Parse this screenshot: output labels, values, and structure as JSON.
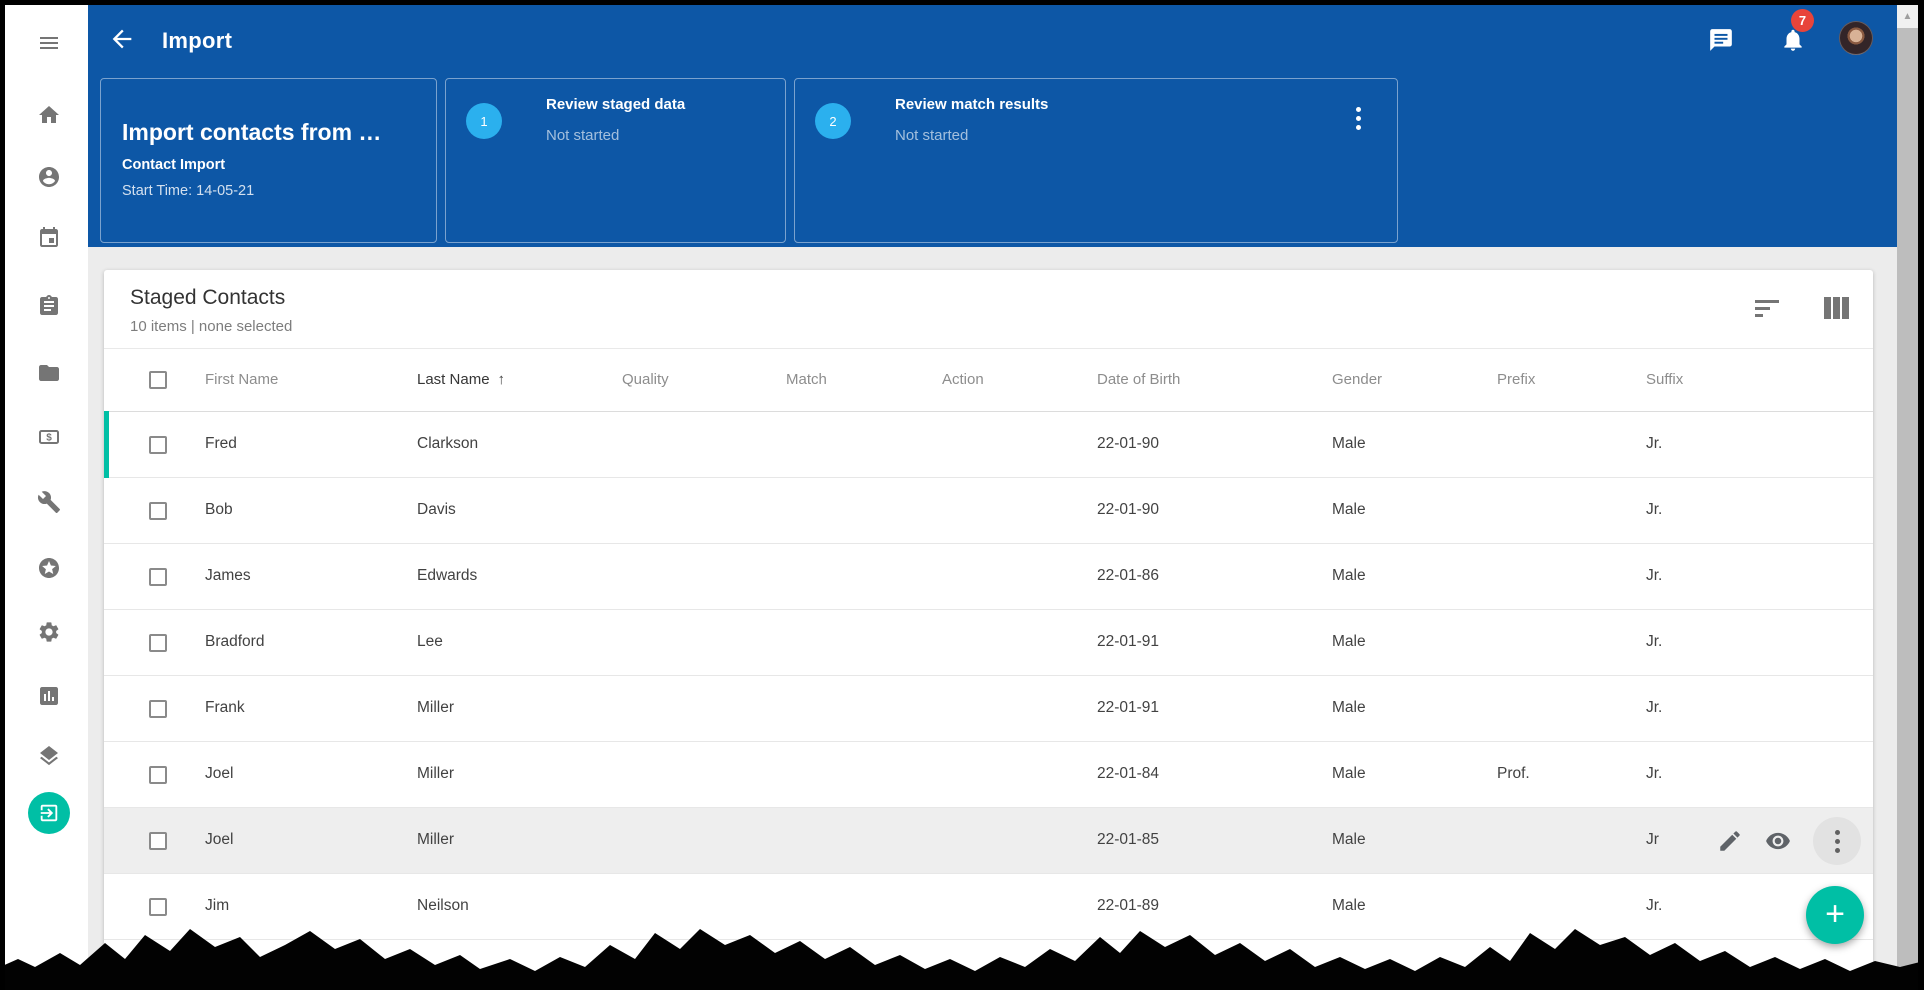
{
  "app_bar": {
    "title": "Import",
    "notifications_badge": "7"
  },
  "sidebar": {
    "items": [
      "menu",
      "home",
      "contacts",
      "calendar",
      "tasks",
      "documents",
      "payments",
      "tools",
      "featured",
      "settings",
      "reports",
      "layers",
      "import"
    ]
  },
  "wizard": {
    "summary": {
      "title": "Import contacts from …",
      "type": "Contact Import",
      "start_time": "Start Time: 14-05-21"
    },
    "steps": [
      {
        "number": "1",
        "title": "Review staged data",
        "status": "Not started"
      },
      {
        "number": "2",
        "title": "Review match results",
        "status": "Not started"
      }
    ]
  },
  "content": {
    "title": "Staged Contacts",
    "summary": "10 items | none selected",
    "sort_indicator": "↑",
    "sorted_column": "Last Name",
    "columns": [
      "First Name",
      "Last Name",
      "Quality",
      "Match",
      "Action",
      "Date of Birth",
      "Gender",
      "Prefix",
      "Suffix"
    ],
    "rows": [
      {
        "first": "Fred",
        "last": "Clarkson",
        "quality": "",
        "match": "",
        "action": "",
        "dob": "22-01-90",
        "gender": "Male",
        "prefix": "",
        "suffix": "Jr.",
        "accent": true
      },
      {
        "first": "Bob",
        "last": "Davis",
        "quality": "",
        "match": "",
        "action": "",
        "dob": "22-01-90",
        "gender": "Male",
        "prefix": "",
        "suffix": "Jr."
      },
      {
        "first": "James",
        "last": "Edwards",
        "quality": "",
        "match": "",
        "action": "",
        "dob": "22-01-86",
        "gender": "Male",
        "prefix": "",
        "suffix": "Jr."
      },
      {
        "first": "Bradford",
        "last": "Lee",
        "quality": "",
        "match": "",
        "action": "",
        "dob": "22-01-91",
        "gender": "Male",
        "prefix": "",
        "suffix": "Jr."
      },
      {
        "first": "Frank",
        "last": "Miller",
        "quality": "",
        "match": "",
        "action": "",
        "dob": "22-01-91",
        "gender": "Male",
        "prefix": "",
        "suffix": "Jr."
      },
      {
        "first": "Joel",
        "last": "Miller",
        "quality": "",
        "match": "",
        "action": "",
        "dob": "22-01-84",
        "gender": "Male",
        "prefix": "Prof.",
        "suffix": "Jr."
      },
      {
        "first": "Joel",
        "last": "Miller",
        "quality": "",
        "match": "",
        "action": "",
        "dob": "22-01-85",
        "gender": "Male",
        "prefix": "",
        "suffix": "Jr",
        "hover": true
      },
      {
        "first": "Jim",
        "last": "Neilson",
        "quality": "",
        "match": "",
        "action": "",
        "dob": "22-01-89",
        "gender": "Male",
        "prefix": "",
        "suffix": "Jr."
      }
    ]
  },
  "fab": {
    "label": "+"
  },
  "colors": {
    "app_bar_blue": "#0d57a6",
    "accent_teal": "#00bfa5",
    "step_circle_blue": "#2bb0ee",
    "badge_red": "#e8443a"
  }
}
